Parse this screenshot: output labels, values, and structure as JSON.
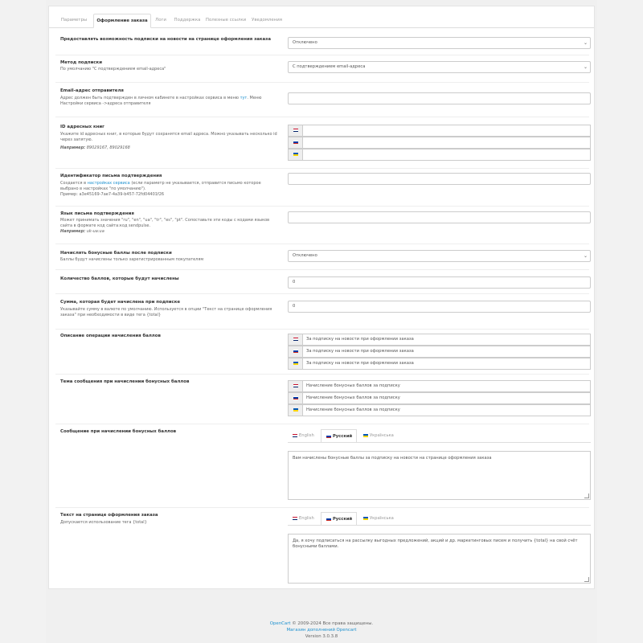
{
  "tabs": [
    "Параметры",
    "Оформление заказа",
    "Логи",
    "Поддержка",
    "Полезные ссылки",
    "Уведомления"
  ],
  "fields": {
    "subscribe": {
      "label": "Предоставлять возможность подписки на новости на странице оформления заказа",
      "value": "Отключено"
    },
    "method": {
      "label": "Метод подписки",
      "help": "По умолчанию \"С подтверждением email-адреса\"",
      "value": "С подтверждением email-адреса"
    },
    "sender": {
      "label": "Email-адрес отправителя",
      "help_a": "Адрес должен быть подтвержден в личном кабинете в настройках сервиса в меню ",
      "help_link": "тут",
      "help_b": ". Меню Настройки сервиса ->адреса отправителя",
      "value": ""
    },
    "books": {
      "label": "ID адресных книг",
      "help": "Укажите id адресных книг, в которые будут сохранятся email адреса. Можно указывать несколько id через запятую.",
      "example_label": "Например:",
      "example": "89029167, 89029168"
    },
    "template": {
      "label": "Идентификатор письма подтверждения",
      "help_a": "Создается в ",
      "help_link": "настройках сервиса",
      "help_b": " (если параметр не указывается, отправится письмо которое выбрано в настройках \"по умолчанию\").",
      "help_c": "Пример: a3e45169-7ae7-4a39-b457-72fd04401f26",
      "value": ""
    },
    "lang": {
      "label": "Язык письма подтверждения",
      "help": "Может принимать значения \"ru\", \"en\", \"ua\", \"tr\", \"es\", \"pt\". Сопоставьте эти коды с кодами языков сайта в формате код сайта:код sendpulse.",
      "example_label": "Например:",
      "example": "uk-ua:ua",
      "value": ""
    },
    "bonus": {
      "label": "Начислять бонусные баллы после подписки",
      "help": "Баллы будут начислены только зарегистрированным покупателям",
      "value": "Отключено"
    },
    "points": {
      "label": "Количество баллов, которые будут начислены",
      "value": "0"
    },
    "amount": {
      "label": "Сумма, которая будет начислена при подписке",
      "help": "Указывайте сумму в валюте по умолчанию. Используется в опции \"Текст на странице оформления заказа\" при необходимости в виде тега {total}",
      "value": "0"
    },
    "desc": {
      "label": "Описание операции начисления баллов",
      "values": [
        "За подписку на новости при оформлении заказа",
        "За подписку на новости при оформлении заказа",
        "За подписку на новости при оформлении заказа"
      ]
    },
    "subject": {
      "label": "Тема сообщения при начислении бонусных баллов",
      "values": [
        "Начисление бонусных баллов за подписку",
        "Начисление бонусных баллов за подписку",
        "Начисление бонусных баллов за подписку"
      ]
    },
    "message": {
      "label": "Сообщение при начислении бонусных баллов",
      "value": "Вам начислены бонусные баллы за подписку на новости на странице оформления заказа"
    },
    "checkout_text": {
      "label": "Текст на странице оформления заказа",
      "help": "Допускается использование тега {total}",
      "value": "Да, я хочу подписаться на рассылку выгодных предложений, акций и др. маркетинговых писем и получить {total} на свой счёт бонусными баллами."
    }
  },
  "lang_tabs": [
    "English",
    "Русский",
    "Українська"
  ],
  "footer": {
    "brand": "OpenCart",
    "copy": " © 2009-2024 Все права защищены.",
    "store": "Магазин дополнений Opencart",
    "version": "Version 3.0.3.8"
  },
  "colors": {
    "link": "#1e91cf",
    "panel": "#ffffff",
    "background": "#f0f0f0"
  }
}
